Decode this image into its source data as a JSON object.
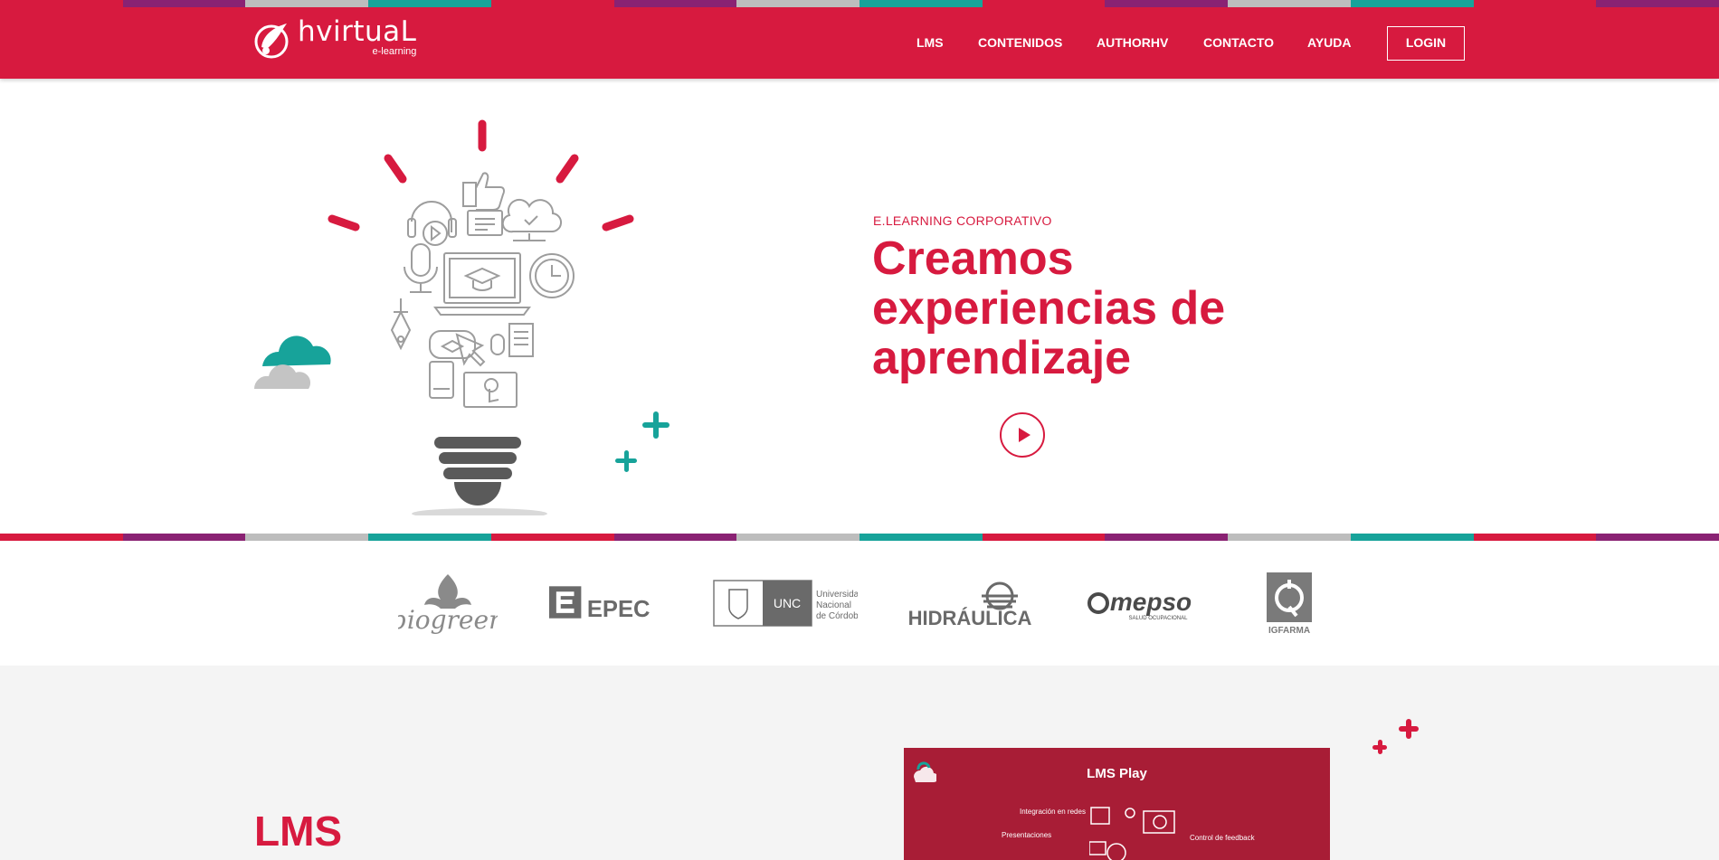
{
  "brand": {
    "name": "hvirtuaL",
    "tagline": "e-learning",
    "primary_color": "#d71a3f",
    "strip_colors": [
      "#d71a3f",
      "#8a2273",
      "#bdbdbd",
      "#17a39a"
    ]
  },
  "nav": {
    "items": [
      {
        "label": "LMS"
      },
      {
        "label": "CONTENIDOS"
      },
      {
        "label": "AUTHORHV"
      },
      {
        "label": "CONTACTO"
      },
      {
        "label": "AYUDA"
      }
    ],
    "login_label": "LOGIN"
  },
  "hero": {
    "eyebrow": "E.LEARNING CORPORATIVO",
    "headline_line1": "Creamos",
    "headline_line2": "experiencias de",
    "headline_line3": "aprendizaje",
    "play_icon": "play-icon"
  },
  "clients": [
    {
      "name": "biogreen"
    },
    {
      "name": "EPEC"
    },
    {
      "name": "UNC",
      "full": [
        "Universidad",
        "Nacional",
        "de Córdoba"
      ]
    },
    {
      "name": "HIDRÁULICA"
    },
    {
      "name": "mepso",
      "sub": "SALUD OCUPACIONAL"
    },
    {
      "name": "IGFARMA"
    }
  ],
  "lms": {
    "title": "LMS",
    "video": {
      "title": "LMS Play",
      "labels": [
        "Integración en redes",
        "Presentaciones",
        "Control de feedback"
      ]
    }
  }
}
